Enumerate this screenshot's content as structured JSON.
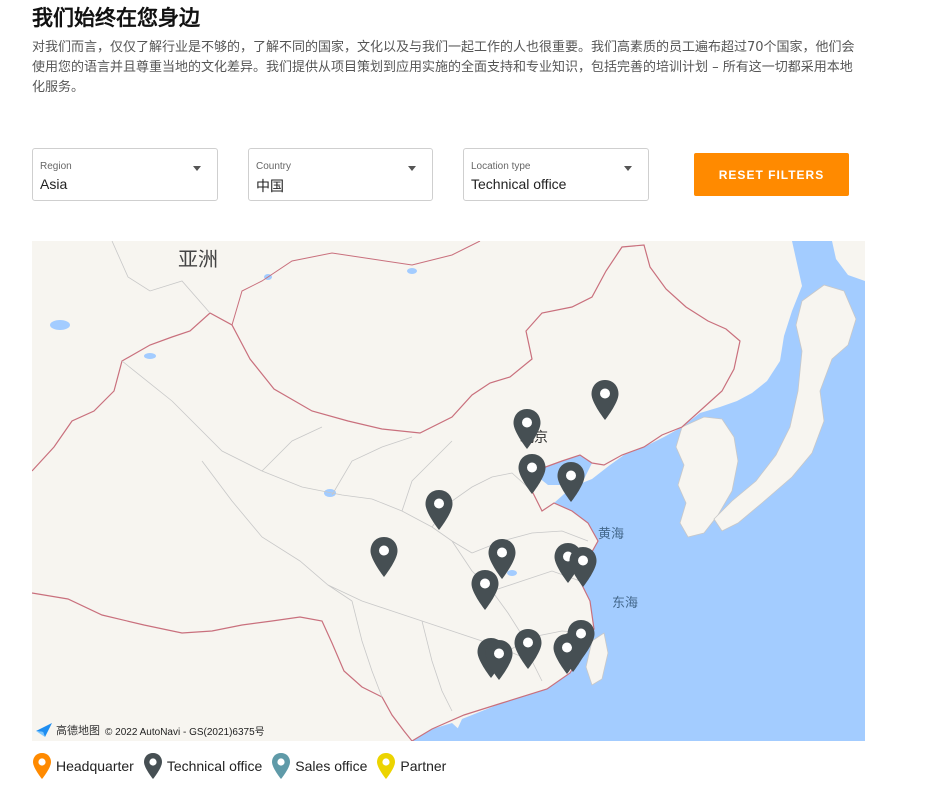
{
  "header": {
    "title": "我们始终在您身边",
    "intro": "对我们而言，仅仅了解行业是不够的，了解不同的国家，文化以及与我们一起工作的人也很重要。我们高素质的员工遍布超过70个国家，他们会使用您的语言并且尊重当地的文化差异。我们提供从项目策划到应用实施的全面支持和专业知识，包括完善的培训计划 – 所有这一切都采用本地化服务。"
  },
  "filters": {
    "region": {
      "label": "Region",
      "value": "Asia"
    },
    "country": {
      "label": "Country",
      "value": "中国"
    },
    "location_type": {
      "label": "Location type",
      "value": "Technical office"
    },
    "reset_label": "RESET FILTERS"
  },
  "map": {
    "labels": {
      "continent": "亚洲",
      "capital": "北京",
      "yellow_sea": "黄海",
      "east_sea": "东海"
    },
    "attribution": {
      "provider_logo": "高德地图",
      "copyright": "© 2022 AutoNavi - GS(2021)6375号"
    },
    "colors": {
      "land": "#f7f5f0",
      "water": "#a3ccff",
      "border": "#c9707d",
      "province_border": "#c8c8c8",
      "pin_technical": "#464f53"
    },
    "pins": [
      {
        "type": "technical-office",
        "name": "pin-shenyang"
      },
      {
        "type": "technical-office",
        "name": "pin-beijing"
      },
      {
        "type": "technical-office",
        "name": "pin-jinan"
      },
      {
        "type": "technical-office",
        "name": "pin-qingdao"
      },
      {
        "type": "technical-office",
        "name": "pin-xian"
      },
      {
        "type": "technical-office",
        "name": "pin-chengdu"
      },
      {
        "type": "technical-office",
        "name": "pin-hefei"
      },
      {
        "type": "technical-office",
        "name": "pin-suzhou"
      },
      {
        "type": "technical-office",
        "name": "pin-shanghai"
      },
      {
        "type": "technical-office",
        "name": "pin-nanchang"
      },
      {
        "type": "technical-office",
        "name": "pin-fuzhou"
      },
      {
        "type": "technical-office",
        "name": "pin-xiamen"
      },
      {
        "type": "technical-office",
        "name": "pin-guangzhou-1"
      },
      {
        "type": "technical-office",
        "name": "pin-guangzhou-2"
      },
      {
        "type": "technical-office",
        "name": "pin-shenzhen"
      },
      {
        "type": "technical-office",
        "name": "pin-taipei"
      }
    ]
  },
  "legend": {
    "items": [
      {
        "label": "Headquarter",
        "color": "#ff8a00",
        "icon": "headquarter-pin-icon"
      },
      {
        "label": "Technical office",
        "color": "#464f53",
        "icon": "technical-office-pin-icon"
      },
      {
        "label": "Sales office",
        "color": "#5f9aa8",
        "icon": "sales-office-pin-icon"
      },
      {
        "label": "Partner",
        "color": "#ecd400",
        "icon": "partner-pin-icon"
      }
    ]
  }
}
